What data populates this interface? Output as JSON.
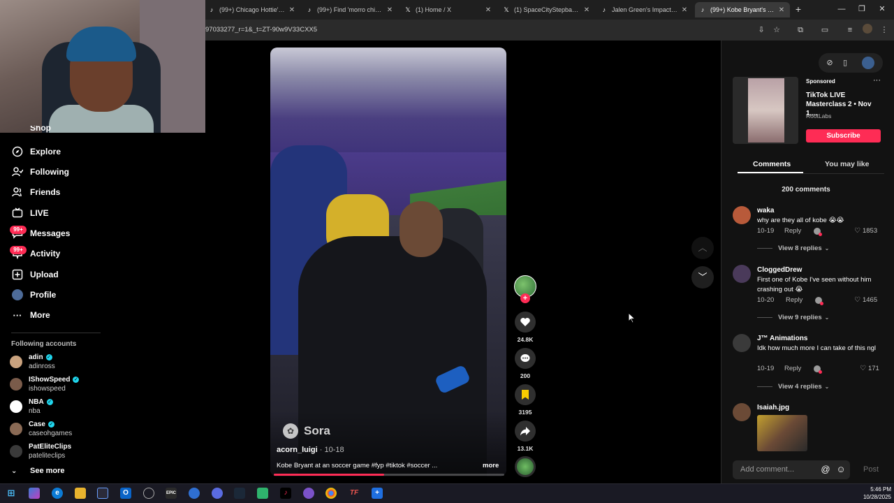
{
  "browser": {
    "tabs": [
      {
        "title": "(99+) Chicago Hottie's Me",
        "icon": "tiktok-icon"
      },
      {
        "title": "(99+) Find 'morro chicago",
        "icon": "tiktok-icon"
      },
      {
        "title": "(1) Home / X",
        "icon": "x-icon"
      },
      {
        "title": "(1) SpaceCityStepback on",
        "icon": "x-icon"
      },
      {
        "title": "Jalen Green's Impact on th",
        "icon": "tiktok-icon"
      },
      {
        "title": "(99+) Kobe Bryant's Memo",
        "icon": "tiktok-icon",
        "active": true
      }
    ],
    "url": "97033277_r=1&_t=ZT-90w9V33CXX5"
  },
  "sidebar": {
    "partial_item": "Shop",
    "items": [
      {
        "label": "Explore",
        "icon": "compass-icon"
      },
      {
        "label": "Following",
        "icon": "following-icon"
      },
      {
        "label": "Friends",
        "icon": "friends-icon"
      },
      {
        "label": "LIVE",
        "icon": "live-icon"
      },
      {
        "label": "Messages",
        "icon": "messages-icon",
        "badge": "99+"
      },
      {
        "label": "Activity",
        "icon": "activity-icon",
        "badge": "99+"
      },
      {
        "label": "Upload",
        "icon": "upload-icon"
      },
      {
        "label": "Profile",
        "icon": "profile-avatar"
      },
      {
        "label": "More",
        "icon": "more-icon"
      }
    ],
    "following_heading": "Following accounts",
    "accounts": [
      {
        "name": "adin",
        "handle": "adinross",
        "verified": true,
        "color": "#c9a27e"
      },
      {
        "name": "IShowSpeed",
        "handle": "ishowspeed",
        "verified": true,
        "color": "#7a5b4a"
      },
      {
        "name": "NBA",
        "handle": "nba",
        "verified": true,
        "color": "#ffffff"
      },
      {
        "name": "Case",
        "handle": "caseohgames",
        "verified": true,
        "color": "#8a6a55"
      },
      {
        "name": "PatEliteClips",
        "handle": "pateliteclips",
        "verified": false,
        "color": "#3a3a3a"
      }
    ],
    "see_more": "See more"
  },
  "video": {
    "watermark": "Sora",
    "author": "acorn_luigi",
    "date": "· 10-18",
    "caption": "Kobe Bryant at an soccer game #fyp #tiktok #soccer ...",
    "more": "more",
    "progress": 0.48
  },
  "actions": {
    "likes": "24.8K",
    "comments": "200",
    "saves": "3195",
    "shares": "13.1K"
  },
  "ad": {
    "sponsored": "Sponsored",
    "title": "TikTok LIVE Masterclass 2 • Nov 1,...",
    "brand": "RootLabs",
    "cta": "Subscribe"
  },
  "panel": {
    "tab_comments": "Comments",
    "tab_you_may_like": "You may like",
    "comment_count": "200 comments",
    "add_placeholder": "Add comment...",
    "post": "Post",
    "reply_label": "Reply"
  },
  "comments": [
    {
      "user": "waka",
      "text": "why are they all of kobe 😭😭",
      "date": "10-19",
      "likes": "1853",
      "replies": "View 8 replies",
      "color": "#b85a3a"
    },
    {
      "user": "CloggedDrew",
      "text": "First one of Kobe I've seen without him crashing out 😭",
      "date": "10-20",
      "likes": "1465",
      "replies": "View 9 replies",
      "color": "#4a3a5a"
    },
    {
      "user": "J™ Animations",
      "text": "Idk how much more I can take of this ngl",
      "date": "10-19",
      "likes": "171",
      "replies": "View 4 replies",
      "color": "#3a3a3a"
    },
    {
      "user": "Isaiah.jpg",
      "color": "#6b4a36"
    }
  ],
  "taskbar": {
    "time": "5:46 PM",
    "date": "10/28/2025"
  }
}
